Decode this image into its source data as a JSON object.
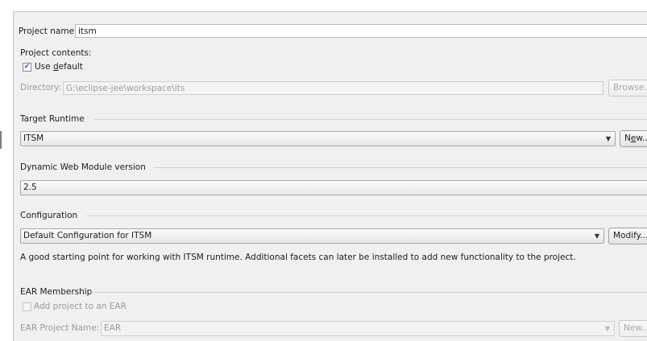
{
  "project_name": {
    "label": "Project name:",
    "value": "itsm"
  },
  "project_contents": {
    "label": "Project contents:",
    "use_default": {
      "label_before": "Use ",
      "mnemonic": "d",
      "label_after": "efault",
      "checked": true
    },
    "directory": {
      "label": "Directory:",
      "value": "G:\\eclipse-jee\\workspace\\its",
      "browse_label": "Browse..."
    }
  },
  "target_runtime": {
    "group_label": "Target Runtime",
    "selected": "ITSM",
    "new_label_before": "N",
    "new_mnemonic": "e",
    "new_label_after": "w..."
  },
  "web_module": {
    "group_label": "Dynamic Web Module version",
    "selected": "2.5"
  },
  "configuration": {
    "group_label": "Configuration",
    "selected": "Default Configuration for ITSM",
    "modify_label": "Modify...",
    "description": "A good starting point for working with ITSM runtime. Additional facets can later be installed to add new functionality to the project."
  },
  "ear_membership": {
    "group_label": "EAR Membership",
    "add_to_ear": {
      "label": "Add project to an EAR",
      "checked": false
    },
    "ear_project_name": {
      "label": "EAR Project Name:",
      "value": "EAR"
    },
    "new_label": "New..."
  },
  "icons": {
    "dropdown": "chevron-down-icon",
    "check": "checkmark-icon"
  },
  "colors": {
    "panel_bg": "#f0f0f0",
    "field_border": "#b9b9b9",
    "disabled_text": "#9a9a9a",
    "check_color": "#2a52be"
  }
}
